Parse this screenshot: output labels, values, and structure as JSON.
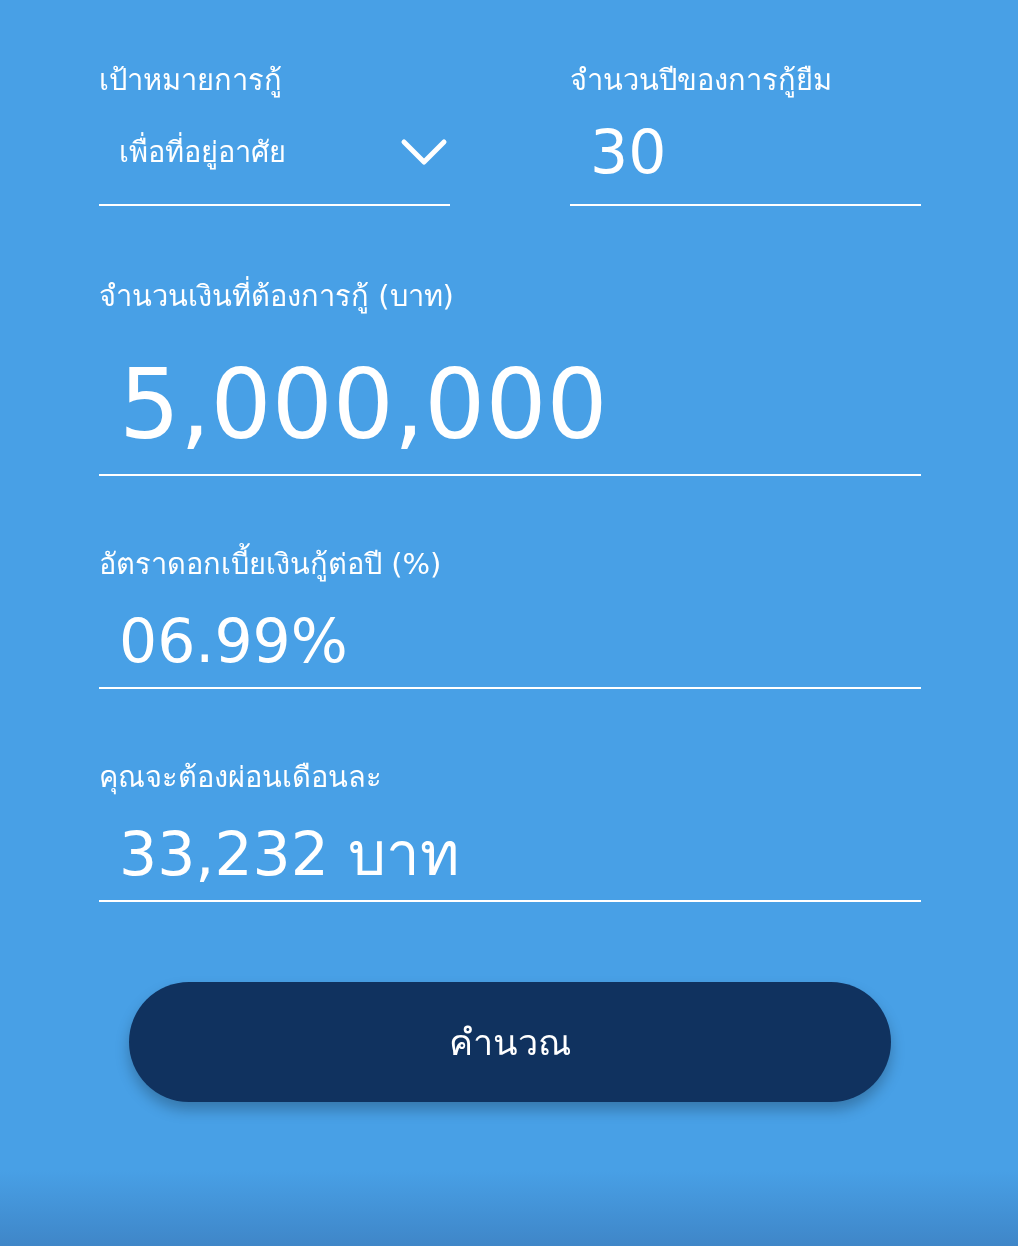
{
  "loan_purpose": {
    "label": "เป้าหมายการกู้",
    "value": "เพื่อที่อยู่อาศัย"
  },
  "loan_years": {
    "label": "จำนวนปีของการกู้ยืม",
    "value": "30"
  },
  "loan_amount": {
    "label": "จำนวนเงินที่ต้องการกู้ (บาท)",
    "value": "5,000,000"
  },
  "interest_rate": {
    "label": "อัตราดอกเบี้ยเงินกู้ต่อปี (%)",
    "value": "06.99%"
  },
  "monthly_payment": {
    "label": "คุณจะต้องผ่อนเดือนละ",
    "value": "33,232 บาท"
  },
  "button": {
    "label": "คำนวณ"
  }
}
